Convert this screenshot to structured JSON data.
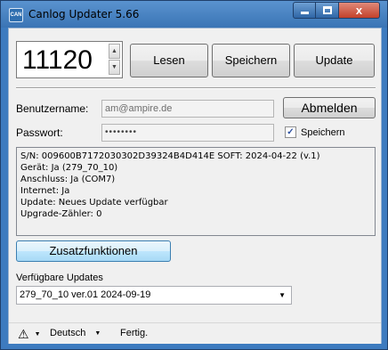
{
  "window": {
    "icon_text": "CAN",
    "title": "Canlog Updater 5.66",
    "controls": {
      "close_glyph": "x"
    }
  },
  "counter": {
    "value": "11120",
    "up_glyph": "▲",
    "down_glyph": "▼"
  },
  "toolbar": {
    "read_label": "Lesen",
    "save_label": "Speichern",
    "update_label": "Update"
  },
  "login": {
    "username_label": "Benutzername:",
    "username_value": "am@ampire.de",
    "password_label": "Passwort:",
    "password_value": "••••••••",
    "logout_label": "Abmelden",
    "save_checkbox_label": "Speichern",
    "save_checked": true
  },
  "info_lines": [
    "S/N: 009600B7172030302D39324B4D414E SOFT: 2024-04-22 (v.1)",
    "Gerät: Ja (279_70_10)",
    "Anschluss: Ja (COM7)",
    "Internet: Ja",
    "Update: Neues Update verfügbar",
    "Upgrade-Zähler: 0"
  ],
  "extra_functions_label": "Zusatzfunktionen",
  "updates": {
    "label": "Verfügbare Updates",
    "selected": "279_70_10 ver.01  2024-09-19"
  },
  "statusbar": {
    "warning_icon": "warning-icon",
    "language": "Deutsch",
    "status": "Fertig."
  },
  "colors": {
    "titlebar": "#3d7bbf",
    "accent_button": "#bee6fd",
    "close_button": "#c3412b"
  }
}
